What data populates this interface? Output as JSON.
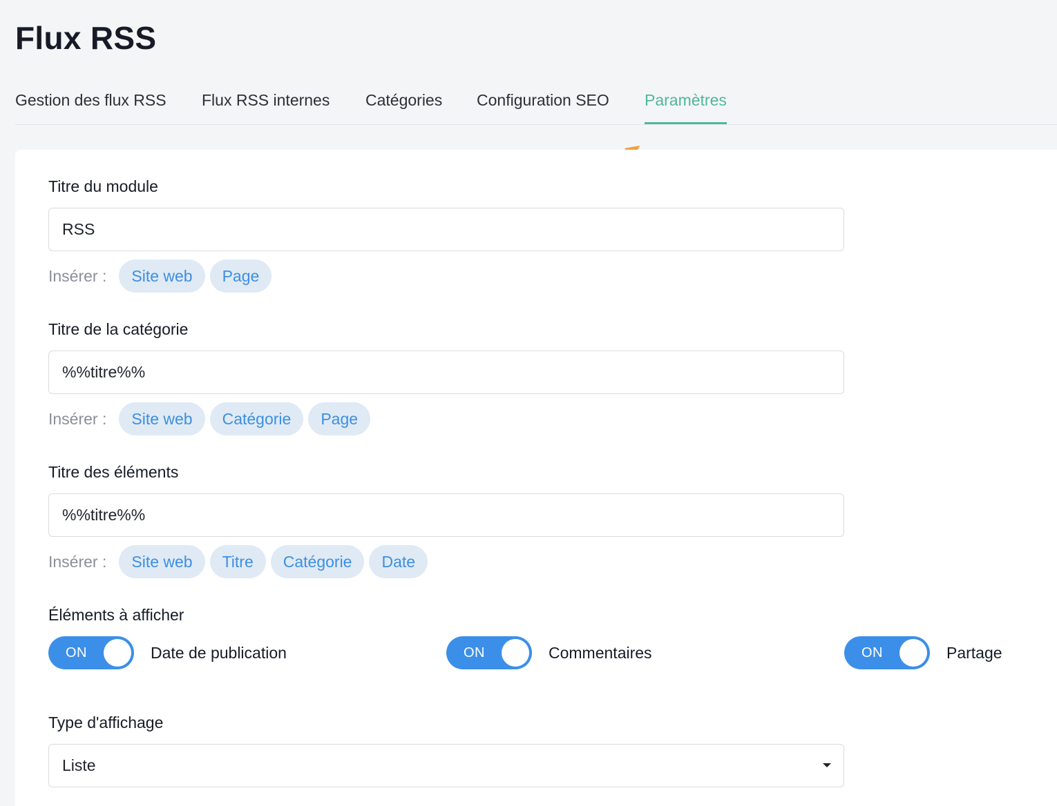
{
  "page": {
    "title": "Flux RSS"
  },
  "tabs": [
    {
      "label": "Gestion des flux RSS",
      "active": false
    },
    {
      "label": "Flux RSS internes",
      "active": false
    },
    {
      "label": "Catégories",
      "active": false
    },
    {
      "label": "Configuration SEO",
      "active": false
    },
    {
      "label": "Paramètres",
      "active": true
    }
  ],
  "form": {
    "insert_label": "Insérer :",
    "module_title": {
      "label": "Titre du module",
      "value": "RSS",
      "chips": [
        "Site web",
        "Page"
      ]
    },
    "category_title": {
      "label": "Titre de la catégorie",
      "value": "%%titre%%",
      "chips": [
        "Site web",
        "Catégorie",
        "Page"
      ]
    },
    "items_title": {
      "label": "Titre des éléments",
      "value": "%%titre%%",
      "chips": [
        "Site web",
        "Titre",
        "Catégorie",
        "Date"
      ]
    },
    "display_elements": {
      "label": "Éléments à afficher",
      "toggles": [
        {
          "state": "ON",
          "caption": "Date de publication"
        },
        {
          "state": "ON",
          "caption": "Commentaires"
        },
        {
          "state": "ON",
          "caption": "Partage"
        }
      ]
    },
    "display_type": {
      "label": "Type d'affichage",
      "value": "Liste"
    }
  },
  "colors": {
    "accent_green": "#4fb79a",
    "toggle_blue": "#3b8fe8",
    "chip_bg": "#dfeaf5",
    "chip_text": "#3d8fe0",
    "annotation_arrow": "#f0a23a"
  }
}
